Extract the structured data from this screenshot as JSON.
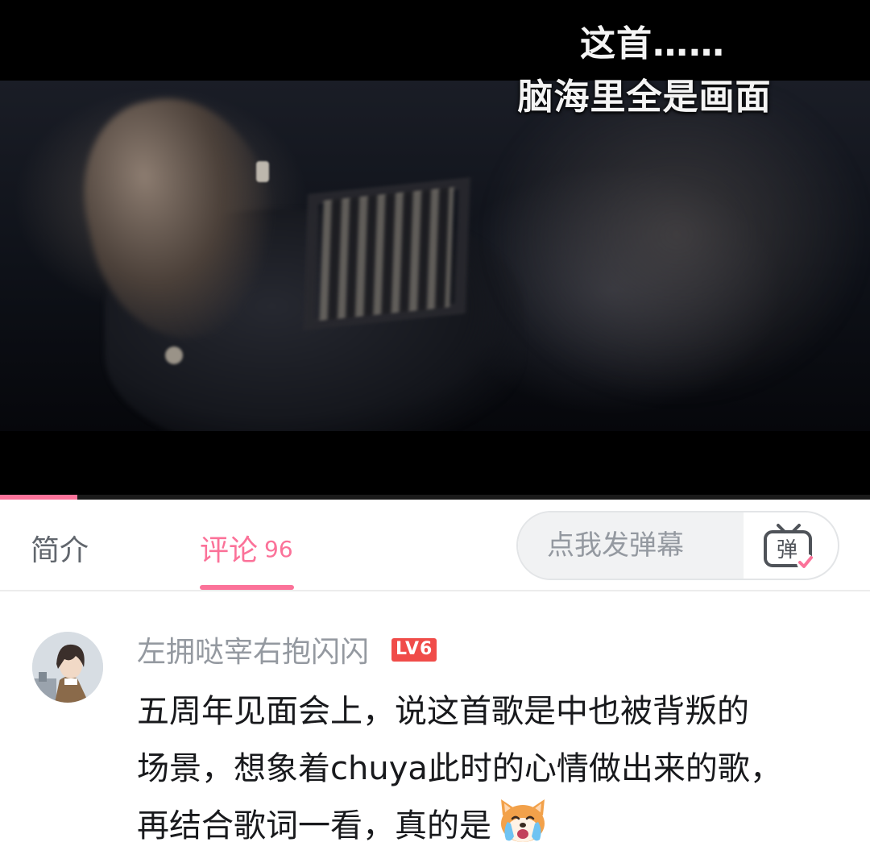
{
  "player": {
    "subtitle_line1": "这首……",
    "subtitle_line2": "脑海里全是画面",
    "progress_fraction": 0.089
  },
  "tabs": {
    "intro_label": "简介",
    "comments_label": "评论",
    "comments_count": "96"
  },
  "danmaku": {
    "placeholder": "点我发弹幕",
    "button_icon": "danmaku-toggle-icon",
    "button_glyph": "弹"
  },
  "comment": {
    "username": "左拥哒宰右抱闪闪",
    "level": "LV6",
    "lines": [
      "五周年见面会上，说这首歌是中也被背叛的",
      "场景，想象着chuya此时的心情做出来的歌，",
      "再结合歌词一看，真的是"
    ],
    "emoji_icon": "crying-dog-emoji"
  },
  "colors": {
    "accent": "#fb7299",
    "level_badge": "#f04c49",
    "muted_text": "#9499a0",
    "body_text": "#18191c"
  }
}
